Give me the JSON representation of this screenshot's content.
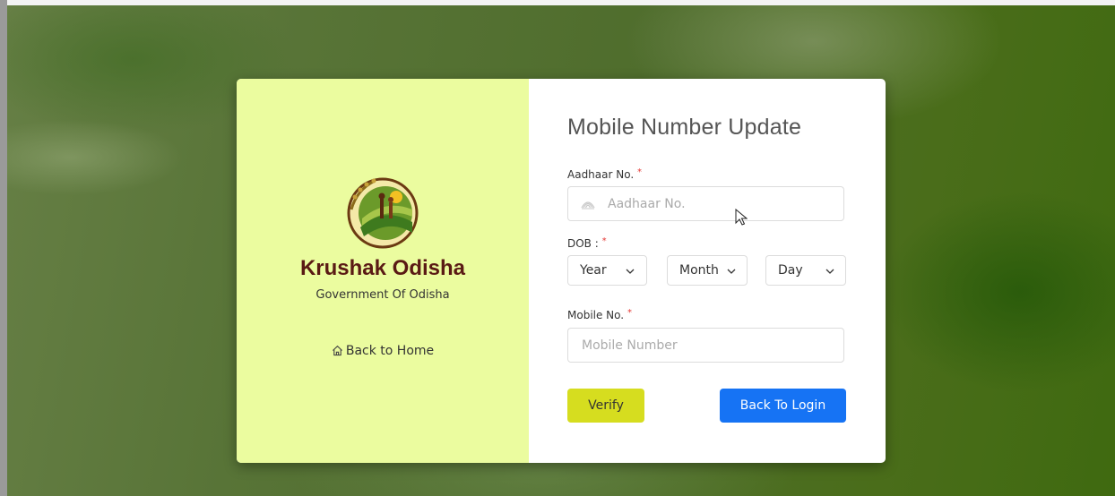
{
  "brand": {
    "name": "Krushak Odisha",
    "subtitle": "Government Of Odisha",
    "home_link": "Back to Home",
    "logo_text": "Krushak Odisha"
  },
  "form": {
    "title": "Mobile Number Update",
    "aadhaar_label": "Aadhaar No.",
    "aadhaar_placeholder": "Aadhaar No.",
    "dob_label": "DOB :",
    "dob_year": "Year",
    "dob_month": "Month",
    "dob_day": "Day",
    "mobile_label": "Mobile No.",
    "mobile_placeholder": "Mobile Number",
    "required_mark": "*",
    "verify_button": "Verify",
    "login_button": "Back To Login"
  },
  "colors": {
    "brand_panel": "#ebfc9f",
    "brand_name": "#5a1a14",
    "verify": "#d6dd1f",
    "login": "#1673f4",
    "required": "#e53935"
  },
  "icons": [
    "home-icon",
    "aadhaar-icon",
    "chevron-down-icon",
    "mouse-cursor-icon"
  ]
}
